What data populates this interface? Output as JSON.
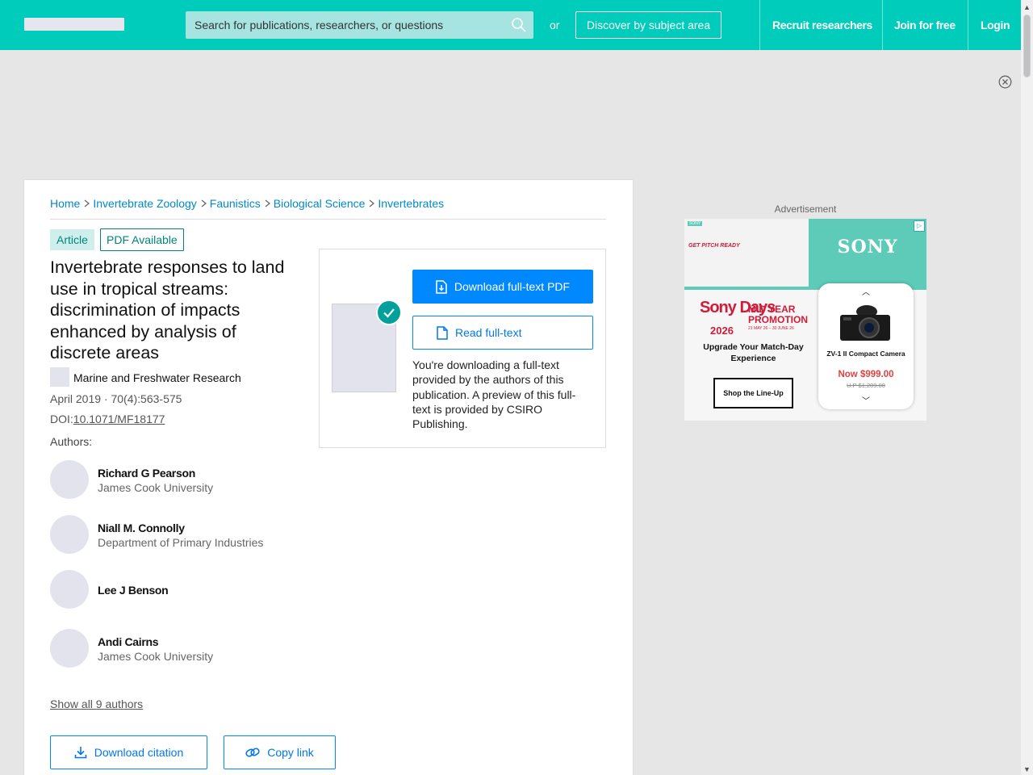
{
  "header": {
    "search_placeholder": "Search for publications, researchers, or questions",
    "or_label": "or",
    "discover_label": "Discover by subject area",
    "nav": [
      "Recruit researchers",
      "Join for free",
      "Login"
    ]
  },
  "breadcrumb": [
    "Home",
    "Invertebrate Zoology",
    "Faunistics",
    "Biological Science",
    "Invertebrates"
  ],
  "article": {
    "type_badge": "Article",
    "pdf_badge": "PDF Available",
    "title": "Invertebrate responses to land use in tropical streams: discrimination of impacts enhanced by analysis of discrete areas",
    "journal": "Marine and Freshwater Research",
    "meta": "April 2019 · 70(4):563-575",
    "doi_label": "DOI:",
    "doi": "10.1071/MF18177",
    "authors_label": "Authors:",
    "authors": [
      {
        "name": "Richard G Pearson",
        "institution": "James Cook University"
      },
      {
        "name": "Niall M. Connolly",
        "institution": "Department of Primary Industries"
      },
      {
        "name": "Lee J Benson",
        "institution": ""
      },
      {
        "name": "Andi Cairns",
        "institution": "James Cook University"
      }
    ],
    "show_all": "Show all 9 authors",
    "download_citation": "Download citation",
    "copy_link": "Copy link"
  },
  "download": {
    "primary_label": "Download full-text PDF",
    "read_label": "Read full-text",
    "note": "You're downloading a full-text provided by the authors of this publication. A preview of this full-text is provided by CSIRO Publishing."
  },
  "ad": {
    "label": "Advertisement",
    "brand": "SONY",
    "small_tag": "SONY",
    "tagline": "GET PITCH READY",
    "sony_days": "Sony Days",
    "year": "2026",
    "mid_year": "MID YEAR PROMOTION",
    "dates": "21 MAY 26 – 30 JUNE 26",
    "headline": "Upgrade Your Match-Day Experience",
    "cta": "Shop the Line-Up",
    "product": "ZV-1 II Compact Camera",
    "price": "Now $999.00",
    "old_price": "U.P $1,209.00"
  },
  "colors": {
    "brand_teal": "#00ccbb",
    "primary_blue": "#0088ff",
    "link_blue": "#0088cc",
    "badge_green": "#00857a",
    "sony_red": "#d01c3a"
  }
}
